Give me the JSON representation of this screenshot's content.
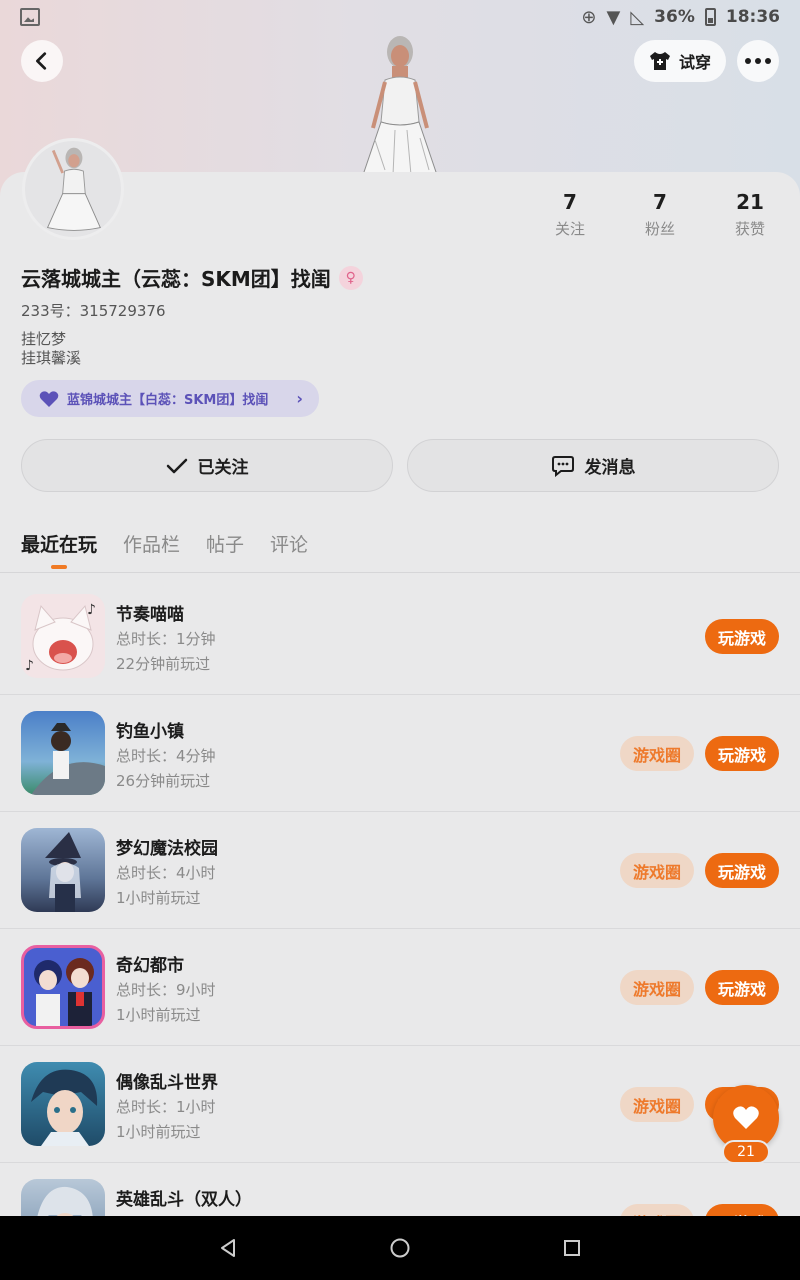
{
  "status_bar": {
    "battery": "36%",
    "time": "18:36"
  },
  "header": {
    "try_on_label": "试穿"
  },
  "profile": {
    "nickname": "云落城城主（云蕊：SKM团】找闺",
    "uid": "233号：315729376",
    "bio": [
      "挂忆梦",
      "挂琪馨溪"
    ],
    "relation_tag": "蓝锦城城主【白蕊：SKM团】找闺",
    "stats": [
      {
        "value": "7",
        "label": "关注"
      },
      {
        "value": "7",
        "label": "粉丝"
      },
      {
        "value": "21",
        "label": "获赞"
      }
    ]
  },
  "actions": {
    "follow_label": "已关注",
    "message_label": "发消息"
  },
  "tabs": [
    {
      "label": "最近在玩",
      "active": true
    },
    {
      "label": "作品栏",
      "active": false
    },
    {
      "label": "帖子",
      "active": false
    },
    {
      "label": "评论",
      "active": false
    }
  ],
  "games": [
    {
      "name": "节奏喵喵",
      "duration": "总时长：1分钟",
      "last_played": "22分钟前玩过",
      "circle": "",
      "play": "玩游戏"
    },
    {
      "name": "钓鱼小镇",
      "duration": "总时长：4分钟",
      "last_played": "26分钟前玩过",
      "circle": "游戏圈",
      "play": "玩游戏"
    },
    {
      "name": "梦幻魔法校园",
      "duration": "总时长：4小时",
      "last_played": "1小时前玩过",
      "circle": "游戏圈",
      "play": "玩游戏"
    },
    {
      "name": "奇幻都市",
      "duration": "总时长：9小时",
      "last_played": "1小时前玩过",
      "circle": "游戏圈",
      "play": "玩游戏"
    },
    {
      "name": "偶像乱斗世界",
      "duration": "总时长：1小时",
      "last_played": "1小时前玩过",
      "circle": "游戏圈",
      "play": "玩游戏"
    },
    {
      "name": "英雄乱斗（双人）",
      "duration": "",
      "last_played": "",
      "circle": "游戏圈",
      "play": "玩游戏"
    }
  ],
  "like_fab": {
    "count": "21"
  },
  "colors": {
    "accent": "#ed6a11",
    "accent_soft": "#efd7c6",
    "tag_bg": "#d8d6ea",
    "tag_text": "#5c52b8"
  }
}
